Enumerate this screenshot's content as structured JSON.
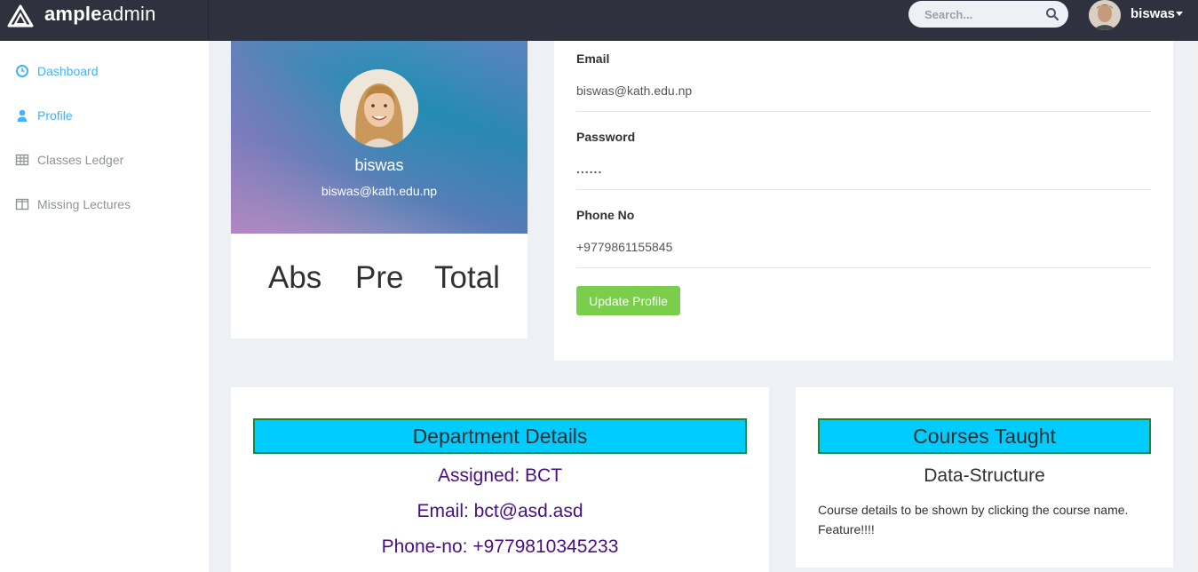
{
  "brand": {
    "name_bold": "ample",
    "name_light": "admin"
  },
  "header": {
    "search_placeholder": "Search...",
    "user_name": "biswas"
  },
  "sidebar": {
    "items": [
      {
        "label": "Dashboard",
        "icon": "clock-icon",
        "active": true
      },
      {
        "label": "Profile",
        "icon": "user-icon",
        "active": true
      },
      {
        "label": "Classes Ledger",
        "icon": "table-icon",
        "active": false
      },
      {
        "label": "Missing Lectures",
        "icon": "columns-icon",
        "active": false
      }
    ]
  },
  "profile": {
    "name": "biswas",
    "email": "biswas@kath.edu.np",
    "stats": [
      "Abs",
      "Pre",
      "Total"
    ]
  },
  "form": {
    "email_label": "Email",
    "email_value": "biswas@kath.edu.np",
    "password_label": "Password",
    "password_value": "......",
    "phone_label": "Phone No",
    "phone_value": "+9779861155845",
    "update_button": "Update Profile"
  },
  "department": {
    "header": "Department Details",
    "assigned": "Assigned: BCT",
    "email": "Email: bct@asd.asd",
    "phone": "Phone-no: +9779810345233"
  },
  "courses": {
    "header": "Courses Taught",
    "course_name": "Data-Structure",
    "description": "Course details to be shown by clicking the course name. Feature!!!!"
  },
  "colors": {
    "topbar": "#2f323e",
    "accent": "#41b3f9",
    "button": "#7ace4c",
    "section_header": "#00ccff",
    "section_border": "#138a3a",
    "dept_text": "#4a0f85"
  }
}
